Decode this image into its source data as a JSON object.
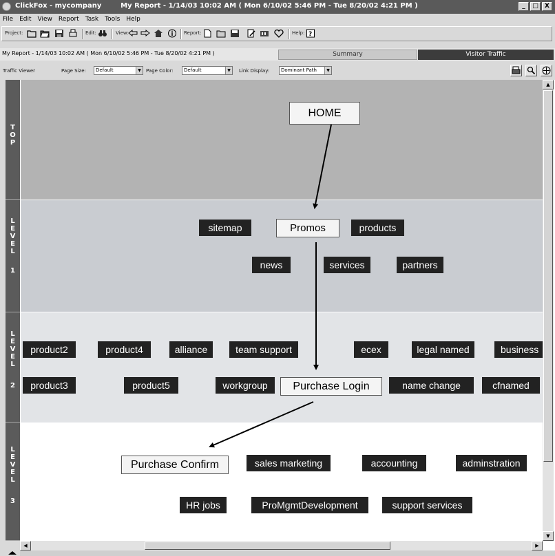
{
  "window": {
    "title": "ClickFox - mycompany        My Report - 1/14/03 10:02 AM ( Mon 6/10/02 5:46 PM - Tue 8/20/02 4:21 PM )",
    "buttons": [
      "_",
      "□",
      "X"
    ]
  },
  "menu": [
    "File",
    "Edit",
    "View",
    "Report",
    "Task",
    "Tools",
    "Help"
  ],
  "toolbar": {
    "project_label": "Project:",
    "edit_label": "Edit:",
    "view_label": "View:",
    "report_label": "Report:",
    "help_label": "Help:"
  },
  "report_bar": {
    "title": "My Report - 1/14/03 10:02 AM ( Mon 6/10/02 5:46 PM - Tue 8/20/02 4:21 PM )",
    "tabs": [
      "Summary",
      "Visitor Traffic"
    ]
  },
  "viewer_options": {
    "viewer_label": "Traffic Viewer",
    "page_size_label": "Page Size:",
    "page_size_value": "Default",
    "page_color_label": "Page Color:",
    "page_color_value": "Default",
    "link_display_label": "Link Display:",
    "link_display_value": "Dominant Path"
  },
  "levels": [
    {
      "letters": [
        "T",
        "O",
        "P"
      ],
      "number": ""
    },
    {
      "letters": [
        "L",
        "E",
        "V",
        "E",
        "L"
      ],
      "number": "1"
    },
    {
      "letters": [
        "L",
        "E",
        "V",
        "E",
        "L"
      ],
      "number": "2"
    },
    {
      "letters": [
        "L",
        "E",
        "V",
        "E",
        "L"
      ],
      "number": "3"
    }
  ],
  "colors": {
    "top_band": "#b3b3b3",
    "level1_band": "#c9ccd1",
    "level2_band": "#e2e4e7",
    "level3_band": "#ffffff",
    "node": "#222222",
    "path_node": "#f4f4f4"
  },
  "nodes": {
    "home": "HOME",
    "sitemap": "sitemap",
    "promos": "Promos",
    "products": "products",
    "news": "news",
    "services": "services",
    "partners": "partners",
    "product2": "product2",
    "product4": "product4",
    "alliance": "alliance",
    "team_support": "team support",
    "ecex": "ecex",
    "legal_named": "legal named",
    "business": "business",
    "product3": "product3",
    "product5": "product5",
    "workgroup": "workgroup",
    "purchase_login": "Purchase Login",
    "name_change": "name change",
    "cfnamed": "cfnamed",
    "purchase_confirm": "Purchase Confirm",
    "sales_marketing": "sales marketing",
    "accounting": "accounting",
    "adminstration": "adminstration",
    "hr_jobs": "HR jobs",
    "promgmt": "ProMgmtDevelopment",
    "support_services": "support services"
  }
}
